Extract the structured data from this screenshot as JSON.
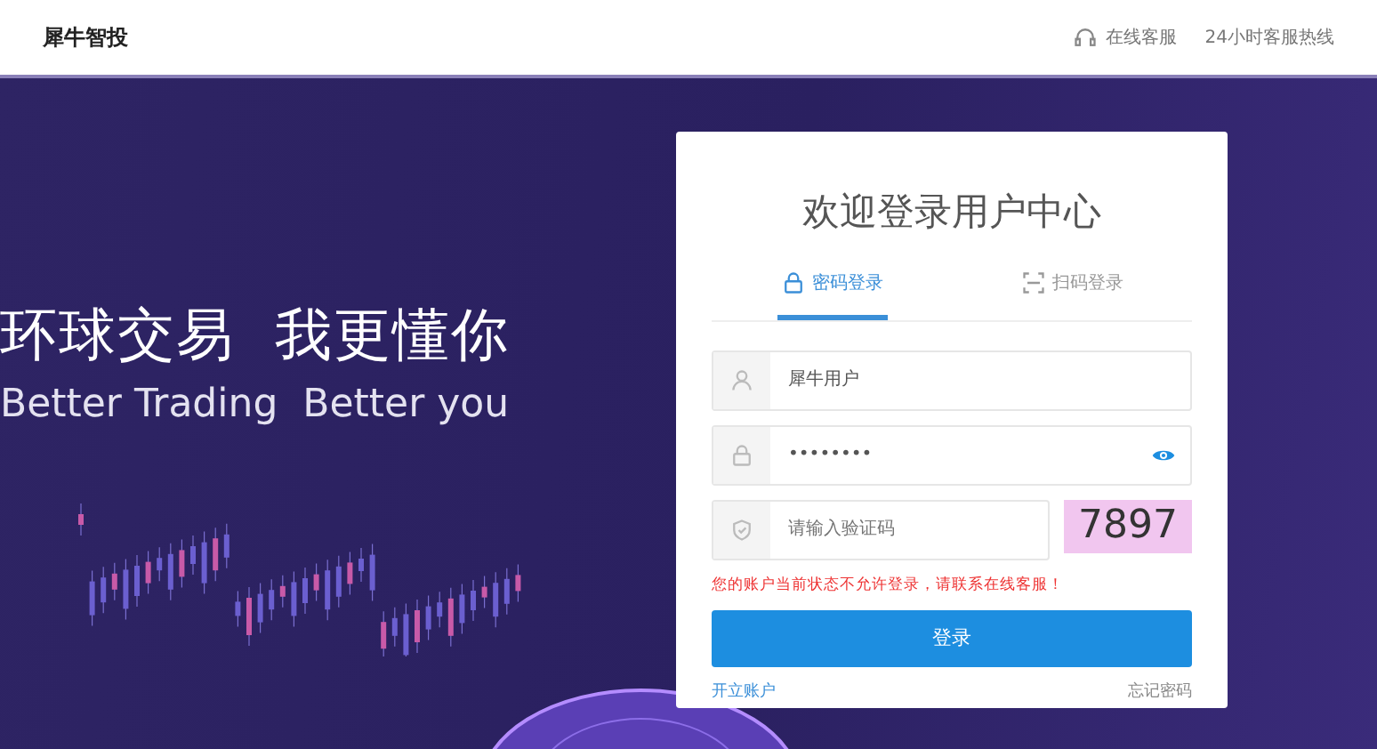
{
  "header": {
    "logo": "犀牛智投",
    "links": [
      {
        "kind": "service",
        "label": "在线客服"
      },
      {
        "kind": "hotline",
        "label": "24小时客服热线"
      }
    ]
  },
  "hero": {
    "headline": "环球交易  我更懂你",
    "subline": "Better Trading  Better you"
  },
  "login": {
    "title": "欢迎登录用户中心",
    "tabs": [
      {
        "kind": "password",
        "label": "密码登录",
        "selected": true
      },
      {
        "kind": "qrcode",
        "label": "扫码登录",
        "selected": false
      }
    ],
    "fields": [
      {
        "kind": "user",
        "value": "犀牛用户"
      },
      {
        "kind": "password",
        "value": "••••••••"
      },
      {
        "kind": "captcha",
        "placeholder": "请输入验证码",
        "code": "7897"
      }
    ],
    "error": "您的账户当前状态不允许登录，请联系在线客服！",
    "submit": "登录",
    "links": [
      {
        "label": "开立账户",
        "kind": "link"
      },
      {
        "label": "忘记密码",
        "kind": "muted"
      }
    ]
  }
}
